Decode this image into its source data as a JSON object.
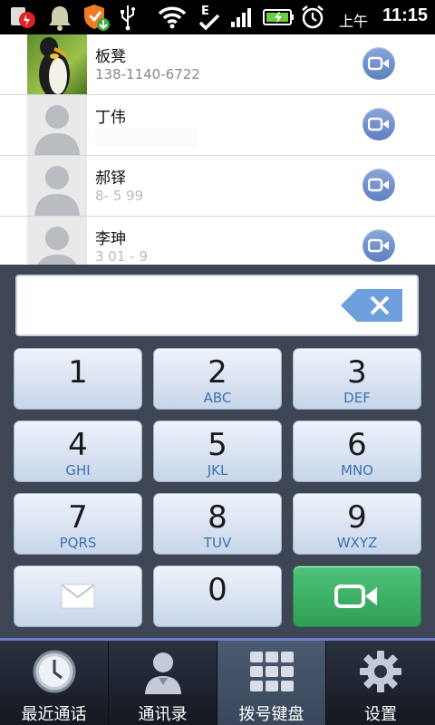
{
  "status_bar": {
    "ampm": "上午",
    "time": "11:15",
    "icons": [
      "notification-red-icon",
      "bell-icon",
      "shield-update-icon",
      "usb-icon",
      "wifi-icon",
      "edge-data-icon",
      "signal-icon",
      "battery-charging-icon",
      "alarm-icon"
    ]
  },
  "contacts": [
    {
      "name": "板凳",
      "number": "138-1140-6722",
      "avatar": "penguin-photo"
    },
    {
      "name": "丁伟",
      "number": "",
      "avatar": "default-avatar"
    },
    {
      "name": "郝铎",
      "number": "8-  5  99",
      "avatar": "default-avatar"
    },
    {
      "name": "李珅",
      "number": "3  01   -   9",
      "avatar": "default-avatar"
    }
  ],
  "dial_input": {
    "value": "",
    "placeholder": ""
  },
  "keypad": [
    {
      "digit": "1",
      "letters": ""
    },
    {
      "digit": "2",
      "letters": "ABC"
    },
    {
      "digit": "3",
      "letters": "DEF"
    },
    {
      "digit": "4",
      "letters": "GHI"
    },
    {
      "digit": "5",
      "letters": "JKL"
    },
    {
      "digit": "6",
      "letters": "MNO"
    },
    {
      "digit": "7",
      "letters": "PQRS"
    },
    {
      "digit": "8",
      "letters": "TUV"
    },
    {
      "digit": "9",
      "letters": "WXYZ"
    },
    {
      "digit": "0",
      "letters": ""
    }
  ],
  "tabs": [
    {
      "label": "最近通话",
      "icon": "clock-icon",
      "active": false
    },
    {
      "label": "通讯录",
      "icon": "person-icon",
      "active": false
    },
    {
      "label": "拨号键盘",
      "icon": "dialpad-icon",
      "active": true
    },
    {
      "label": "设置",
      "icon": "gear-icon",
      "active": false
    }
  ],
  "colors": {
    "accent_blue": "#3e6fb2",
    "call_green": "#2f9f55",
    "dialer_bg": "#3e4656",
    "tab_active_line": "#6f7bd0"
  }
}
